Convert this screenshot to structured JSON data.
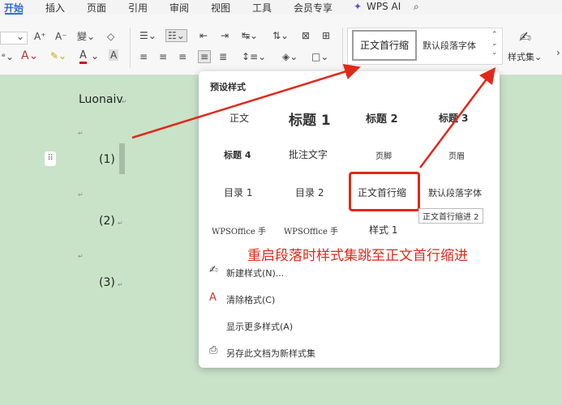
{
  "tabs": [
    {
      "label": "开始",
      "active": true
    },
    {
      "label": "插入"
    },
    {
      "label": "页面"
    },
    {
      "label": "引用"
    },
    {
      "label": "审阅"
    },
    {
      "label": "视图"
    },
    {
      "label": "工具"
    },
    {
      "label": "会员专享"
    },
    {
      "label": "WPS AI"
    }
  ],
  "ribbon": {
    "gallery_first": "正文首行缩",
    "gallery_second": "默认段落字体",
    "styleset_label": "样式集"
  },
  "document": {
    "title": "Luonaiv",
    "items": [
      "(1)",
      "(2)",
      "(3)"
    ]
  },
  "dropdown": {
    "header": "预设样式",
    "styles": [
      "正文",
      "标题 1",
      "标题 2",
      "标题 3",
      "标题 4",
      "批注文字",
      "页脚",
      "页眉",
      "目录 1",
      "目录 2",
      "正文首行缩",
      "默认段落字体",
      "WPSOffice 手",
      "WPSOffice 手",
      "样式 1"
    ],
    "tooltip": "正文首行缩进 2",
    "menu": [
      {
        "label": "新建样式(N)...",
        "icon": "new-style-icon"
      },
      {
        "label": "清除格式(C)",
        "icon": "clear-format-icon"
      },
      {
        "label": "显示更多样式(A)"
      },
      {
        "label": "另存此文档为新样式集",
        "icon": "save-styleset-icon"
      }
    ]
  },
  "annotation": "重启段落时样式集跳至正文首行缩进",
  "colors": {
    "accent": "#2e6bd6",
    "annotation": "#e1281a",
    "background": "#c9e3c9"
  }
}
